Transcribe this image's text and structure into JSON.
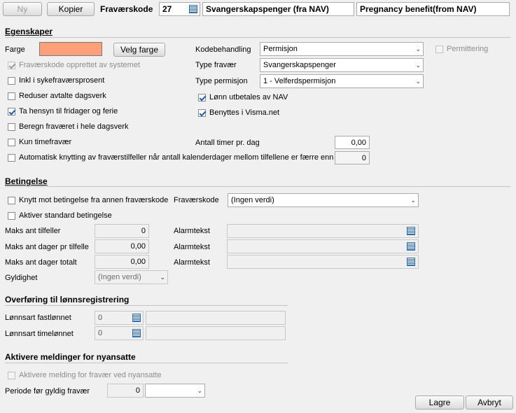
{
  "toolbar": {
    "new_label": "Ny",
    "copy_label": "Kopier",
    "code_label": "Fraværskode",
    "code_value": "27",
    "name_value": "Svangerskapspenger (fra NAV)",
    "name_en_value": "Pregnancy benefit(from NAV)"
  },
  "egenskaper": {
    "title": "Egenskaper",
    "farge_label": "Farge",
    "farge_color": "#ffa07a",
    "velg_farge_label": "Velg farge",
    "left_checks": [
      {
        "label": "Fraværskode opprettet av systemet",
        "checked": true,
        "disabled": true
      },
      {
        "label": "Inkl i sykefraværsprosent",
        "checked": false,
        "disabled": false
      },
      {
        "label": "Reduser avtalte dagsverk",
        "checked": false,
        "disabled": false
      },
      {
        "label": "Ta hensyn til fridager og ferie",
        "checked": true,
        "disabled": false
      },
      {
        "label": "Beregn fraværet i hele dagsverk",
        "checked": false,
        "disabled": false
      },
      {
        "label": "Kun timefravær",
        "checked": false,
        "disabled": false
      },
      {
        "label": "Automatisk knytting av fraværstilfeller når antall kalenderdager mellom tilfellene er færre enn",
        "checked": false,
        "disabled": false
      }
    ],
    "kodebehandling_label": "Kodebehandling",
    "kodebehandling_value": "Permisjon",
    "permittering_label": "Permittering",
    "type_fravaer_label": "Type fravær",
    "type_fravaer_value": "Svangerskapspenger",
    "type_permisjon_label": "Type permisjon",
    "type_permisjon_value": "1 - Velferdspermisjon",
    "lonn_nav_label": "Lønn utbetales av NAV",
    "visma_label": "Benyttes i Visma.net",
    "antall_timer_label": "Antall timer pr. dag",
    "antall_timer_value": "0,00",
    "auto_days_value": "0"
  },
  "betingelse": {
    "title": "Betingelse",
    "knytt_label": "Knytt mot betingelse fra annen fraværskode",
    "fravaerskode_label": "Fraværskode",
    "fravaerskode_value": "(Ingen verdi)",
    "aktiver_label": "Aktiver standard betingelse",
    "rows": [
      {
        "label": "Maks ant tilfeller",
        "value": "0",
        "alarm_label": "Alarmtekst"
      },
      {
        "label": "Maks ant dager pr tilfelle",
        "value": "0,00",
        "alarm_label": "Alarmtekst"
      },
      {
        "label": "Maks ant dager totalt",
        "value": "0,00",
        "alarm_label": "Alarmtekst"
      }
    ],
    "gyldighet_label": "Gyldighet",
    "gyldighet_value": "(Ingen verdi)"
  },
  "overforing": {
    "title": "Overføring til lønnsregistrering",
    "fast_label": "Lønnsart fastlønnet",
    "fast_value": "0",
    "time_label": "Lønnsart timelønnet",
    "time_value": "0"
  },
  "aktivere": {
    "title": "Aktivere meldinger for nyansatte",
    "check_label": "Aktivere melding for fravær ved nyansatte",
    "periode_label": "Periode før gyldig fravær",
    "periode_value": "0"
  },
  "footer": {
    "save_label": "Lagre",
    "cancel_label": "Avbryt"
  },
  "icons": {
    "checkmark": "checkmark-icon",
    "dropdown": "chevron-down-icon",
    "lookup": "list-lookup-icon"
  }
}
